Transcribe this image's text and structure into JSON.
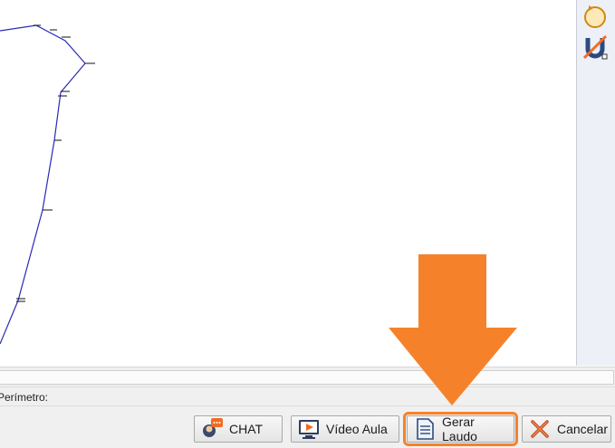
{
  "canvas": {
    "polyline_color": "#2a2ab8"
  },
  "status": {
    "perimeter_label": "Perímetro:"
  },
  "buttons": {
    "chat_label": "CHAT",
    "video_label": "Vídeo Aula",
    "laudo_label": "Gerar Laudo",
    "cancel_label": "Cancelar"
  },
  "side_toolbar": {
    "tools": [
      {
        "icon": "rotate-circle-icon"
      },
      {
        "icon": "magnet-off-icon"
      }
    ]
  },
  "annotation": {
    "arrow_color": "#f5822a",
    "highlight_color": "#f5822a"
  }
}
